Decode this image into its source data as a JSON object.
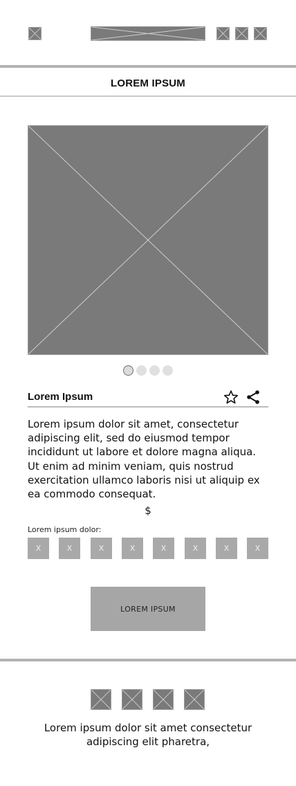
{
  "header": {
    "title": "LOREM IPSUM"
  },
  "carousel": {
    "slide_count": 4,
    "active_index": 0
  },
  "product": {
    "title": "Lorem Ipsum",
    "description": "Lorem ipsum dolor sit amet, consectetur adipiscing elit, sed do eiusmod tempor incididunt ut labore et dolore magna aliqua. Ut enim ad minim veniam, quis nostrud exercitation ullamco laboris nisi ut aliquip ex ea commodo consequat.",
    "price": "$",
    "options_label": "Lorem ipsum dolor:",
    "options": [
      "X",
      "X",
      "X",
      "X",
      "X",
      "X",
      "X",
      "X"
    ]
  },
  "cta": {
    "label": "LOREM IPSUM"
  },
  "footer": {
    "text": "Lorem ipsum dolor sit amet consectetur adipiscing elit pharetra,"
  },
  "icons": {
    "favorite": "star-icon",
    "share": "share-icon"
  },
  "colors": {
    "placeholder": "#7a7a7a",
    "button": "#a6a6a6",
    "divider": "#b3b3b3"
  }
}
